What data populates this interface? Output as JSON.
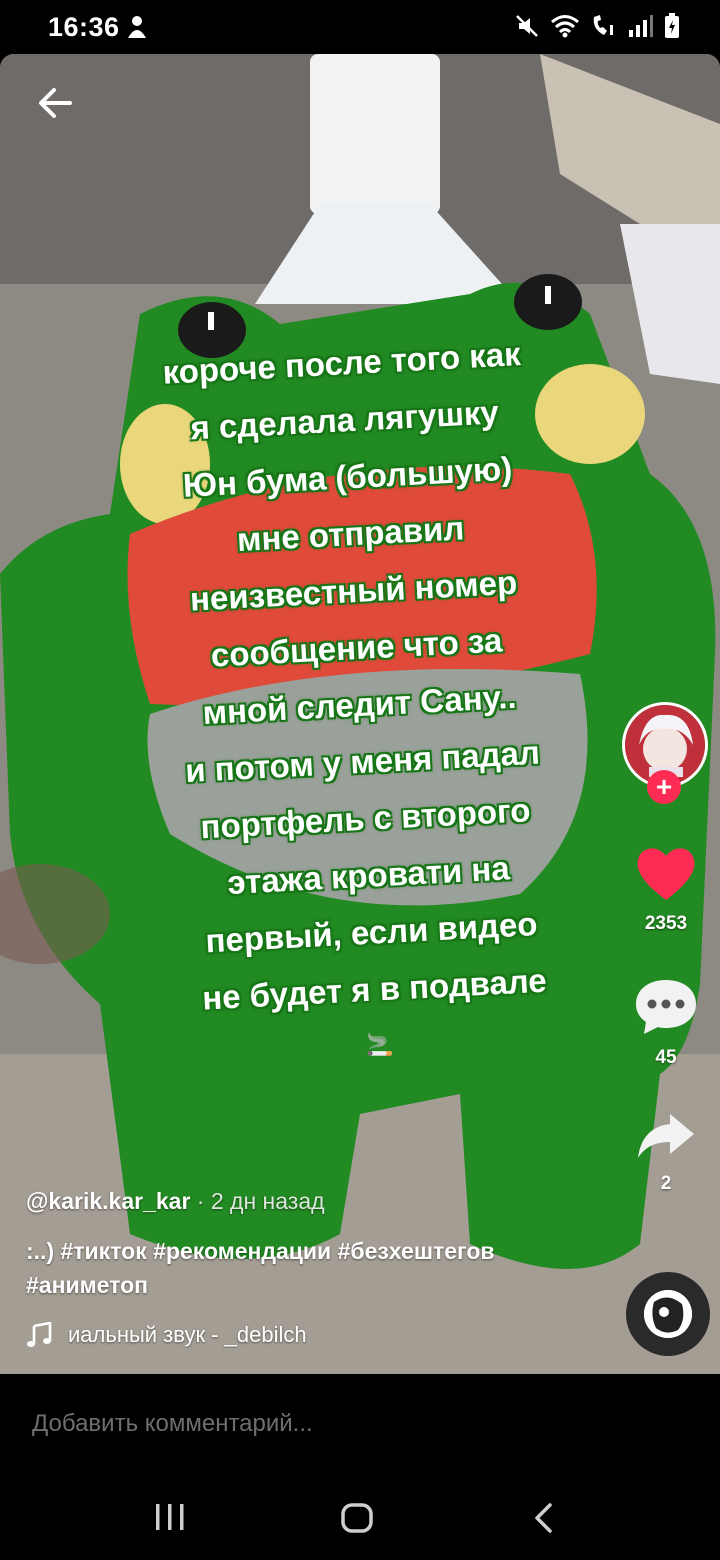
{
  "status_bar": {
    "time": "16:36",
    "icons": [
      "notification-person-icon",
      "mute-icon",
      "wifi-icon",
      "volte-call-icon",
      "signal-icon",
      "battery-icon"
    ]
  },
  "video": {
    "caption_lines": [
      "короче после того как",
      "я сделала лягушку",
      "Юн бума (большую)",
      "мне отправил",
      "неизвестный номер",
      "сообщение что за",
      "мной следит Сану..",
      "и потом у меня падал",
      "портфель с второго",
      "этажа кровати на",
      "первый, если видео",
      "не будет я в подвале"
    ],
    "emoji": "🚬"
  },
  "right_rail": {
    "likes": "2353",
    "comments": "45",
    "shares": "2",
    "like_color": "#fe2c55",
    "follow_symbol": "+"
  },
  "post": {
    "author": "@karik.kar_kar",
    "separator": "·",
    "time_ago": "2 дн назад",
    "description": ":..) #тикток #рекомендации #безхештегов #аниметоп",
    "music": "иальный звук - _debilch"
  },
  "comment_bar": {
    "placeholder": "Добавить комментарий..."
  },
  "nav": {
    "icons": [
      "recent-apps-icon",
      "home-icon",
      "back-icon"
    ]
  }
}
